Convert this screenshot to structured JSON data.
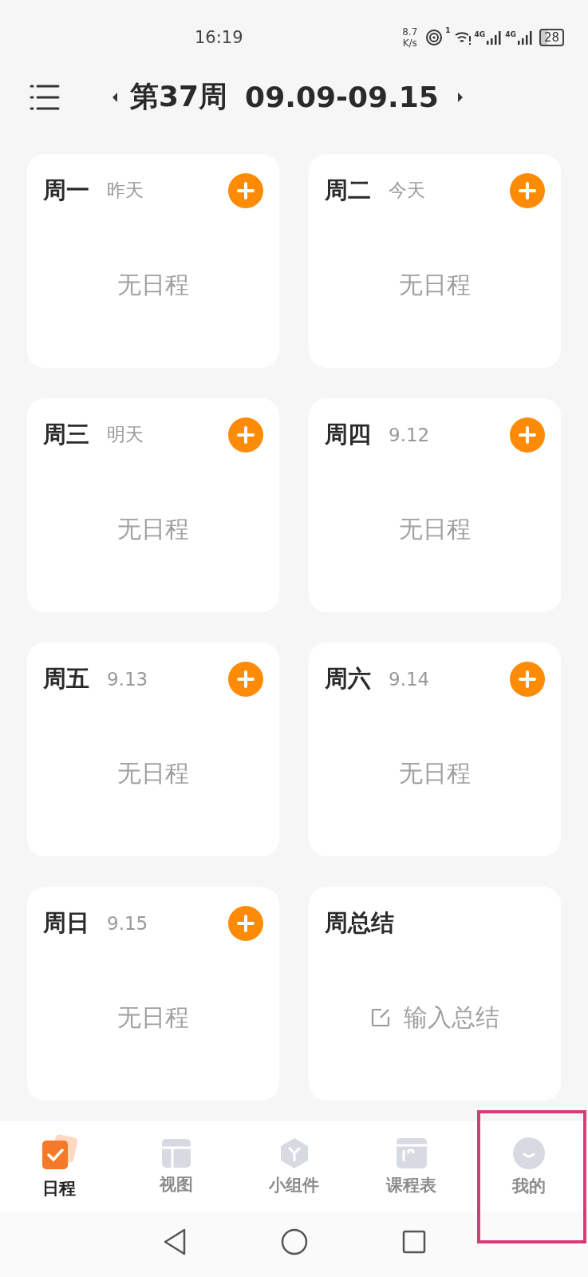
{
  "status_bar": {
    "time": "16:19",
    "speed_value": "8.7",
    "speed_unit": "K/s",
    "hotspot_count": "1",
    "sim1_network": "4G",
    "sim2_network": "4G",
    "battery": "28"
  },
  "header": {
    "week": "第37周",
    "range": "09.09-09.15"
  },
  "cards": [
    {
      "kind": "day",
      "day": "周一",
      "sub": "昨天",
      "empty": "无日程"
    },
    {
      "kind": "day",
      "day": "周二",
      "sub": "今天",
      "empty": "无日程"
    },
    {
      "kind": "day",
      "day": "周三",
      "sub": "明天",
      "empty": "无日程"
    },
    {
      "kind": "day",
      "day": "周四",
      "sub": "9.12",
      "empty": "无日程"
    },
    {
      "kind": "day",
      "day": "周五",
      "sub": "9.13",
      "empty": "无日程"
    },
    {
      "kind": "day",
      "day": "周六",
      "sub": "9.14",
      "empty": "无日程"
    },
    {
      "kind": "day",
      "day": "周日",
      "sub": "9.15",
      "empty": "无日程"
    },
    {
      "kind": "summary",
      "day": "周总结",
      "placeholder": "输入总结"
    }
  ],
  "tabs": [
    {
      "kind": "schedule",
      "label": "日程",
      "selected": true,
      "highlighted": false
    },
    {
      "kind": "view",
      "label": "视图",
      "selected": false,
      "highlighted": false
    },
    {
      "kind": "widget",
      "label": "小组件",
      "selected": false,
      "highlighted": false
    },
    {
      "kind": "timetable",
      "label": "课程表",
      "selected": false,
      "highlighted": false
    },
    {
      "kind": "me",
      "label": "我的",
      "selected": false,
      "highlighted": true
    }
  ]
}
